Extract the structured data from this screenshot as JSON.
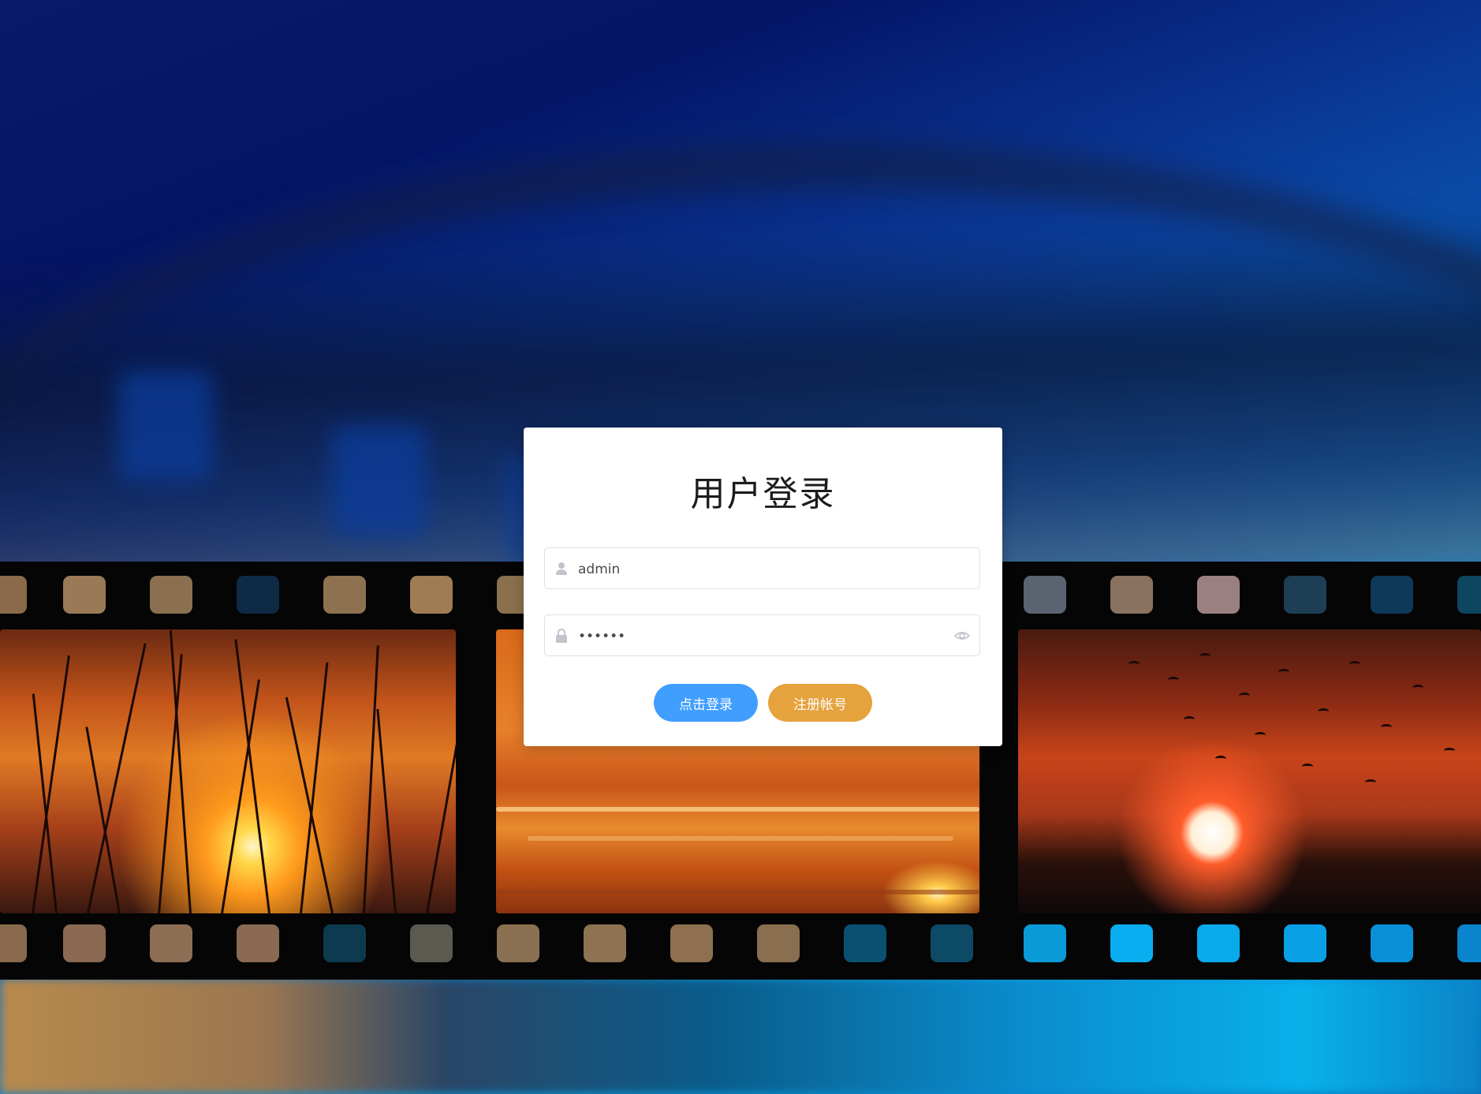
{
  "login": {
    "title": "用户登录",
    "username_value": "admin",
    "password_value": "••••••",
    "login_button": "点击登录",
    "register_button": "注册帐号"
  },
  "icons": {
    "username": "user-icon",
    "password": "lock-icon",
    "toggle_password": "eye-icon"
  },
  "colors": {
    "primary": "#409eff",
    "warning": "#e6a23c",
    "card": "#ffffff"
  }
}
